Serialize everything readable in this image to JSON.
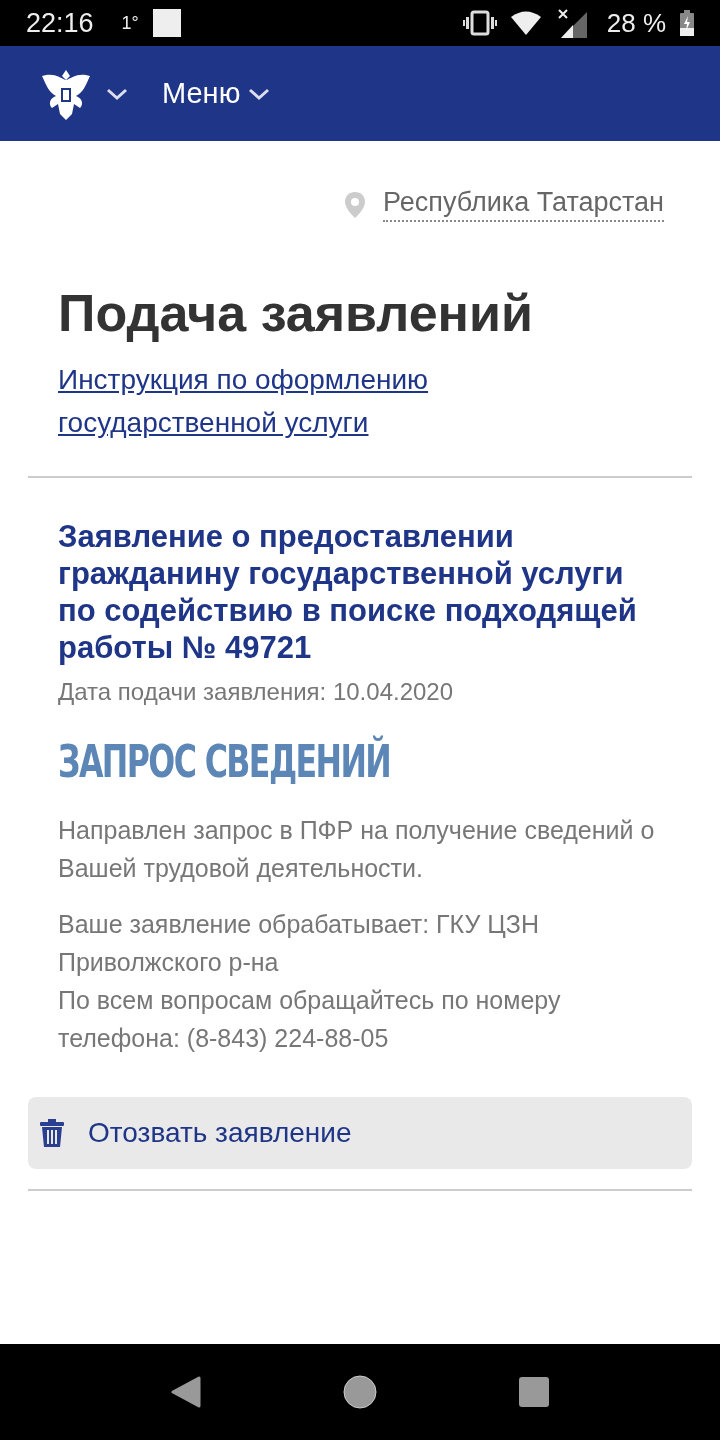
{
  "status_bar": {
    "time": "22:16",
    "temperature": "1°",
    "battery": "28 %"
  },
  "header": {
    "menu_label": "Меню"
  },
  "region": "Республика Татарстан",
  "page_title": "Подача заявлений",
  "instruction_link": "Инструкция по оформлению государственной услуги",
  "application": {
    "title": "Заявление о предоставлении гражданину государственной услуги по содействию в поиске подходящей работы № 49721",
    "date": "Дата подачи заявления: 10.04.2020",
    "status": "ЗАПРОС СВЕДЕНИЙ",
    "paragraphs": [
      "Направлен запрос в ПФР на получение сведений о Вашей трудовой деятельности.",
      "Ваше заявление обрабатывает: ГКУ ЦЗН Приволжского р-на\nПо всем вопросам обращайтесь по номеру телефона: (8-843) 224-88-05"
    ]
  },
  "withdraw_button": "Отозвать заявление"
}
